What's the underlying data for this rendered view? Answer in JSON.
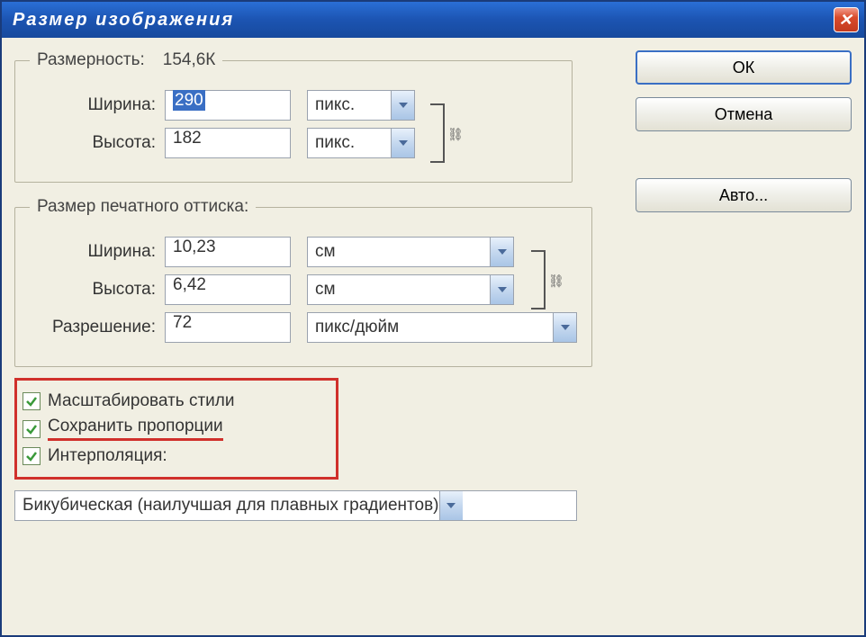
{
  "window": {
    "title": "Размер изображения"
  },
  "buttons": {
    "ok": "ОК",
    "cancel": "Отмена",
    "auto": "Авто..."
  },
  "pixel_dimensions": {
    "legend_label": "Размерность:",
    "legend_value": "154,6К",
    "width_label": "Ширина:",
    "width_value": "290",
    "width_unit": "пикс.",
    "height_label": "Высота:",
    "height_value": "182",
    "height_unit": "пикс."
  },
  "document_size": {
    "legend": "Размер печатного оттиска:",
    "width_label": "Ширина:",
    "width_value": "10,23",
    "width_unit": "см",
    "height_label": "Высота:",
    "height_value": "6,42",
    "height_unit": "см",
    "resolution_label": "Разрешение:",
    "resolution_value": "72",
    "resolution_unit": "пикс/дюйм"
  },
  "options": {
    "scale_styles": "Масштабировать стили",
    "constrain_proportions": "Сохранить пропорции",
    "resample": "Интерполяция:"
  },
  "interpolation": {
    "method": "Бикубическая (наилучшая для плавных градиентов)"
  }
}
